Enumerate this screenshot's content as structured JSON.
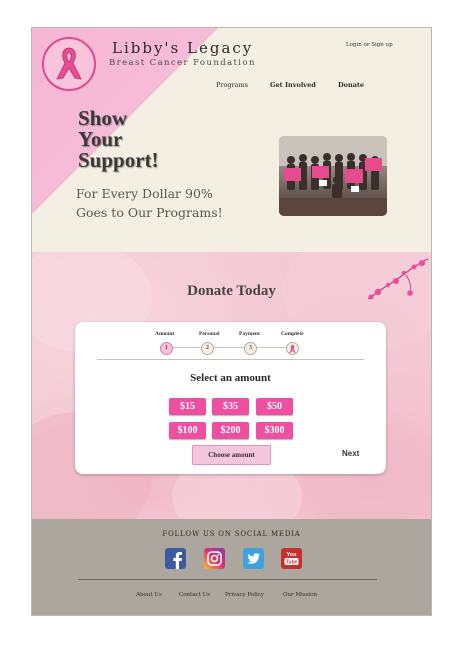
{
  "brand": {
    "name": "Libby's Legacy",
    "subtitle": "Breast Cancer Foundation",
    "logo_icon": "pink-ribbon-icon"
  },
  "header": {
    "login_label": "Login or Sign up",
    "nav": [
      "Programs",
      "Get Involved",
      "Donate"
    ]
  },
  "hero": {
    "headline": [
      "Show",
      "Your",
      "Support!"
    ],
    "tagline": [
      "For Every Dollar 90%",
      "Goes to Our Programs!"
    ],
    "photo_signs": [
      "EARLY DETECTION SAVES LIVES",
      "EARLY DETECTION SAVES LIVES"
    ]
  },
  "donate": {
    "title": "Donate Today",
    "steps": [
      {
        "label": "Amount",
        "number": "1",
        "state": "active"
      },
      {
        "label": "Personal",
        "number": "2",
        "state": "pending"
      },
      {
        "label": "Payment",
        "number": "3",
        "state": "pending"
      },
      {
        "label": "Complete",
        "number": "",
        "icon": "ribbon-icon",
        "state": "pending"
      }
    ],
    "select_title": "Select an amount",
    "amounts": [
      "$15",
      "$35",
      "$50",
      "$100",
      "$200",
      "$300"
    ],
    "choose_label": "Choose amount",
    "next_label": "Next"
  },
  "footer": {
    "follow_label": "FOLLOW US ON SOCIAL MEDIA",
    "social": [
      "facebook-icon",
      "instagram-icon",
      "twitter-icon",
      "youtube-icon"
    ],
    "links": [
      "About Us",
      "Contact Us",
      "Privacy Policy",
      "Our Mission"
    ]
  },
  "colors": {
    "accent_pink": "#ef4fa0",
    "hero_bg": "#f3efe2",
    "footer_bg": "#aca69f"
  }
}
